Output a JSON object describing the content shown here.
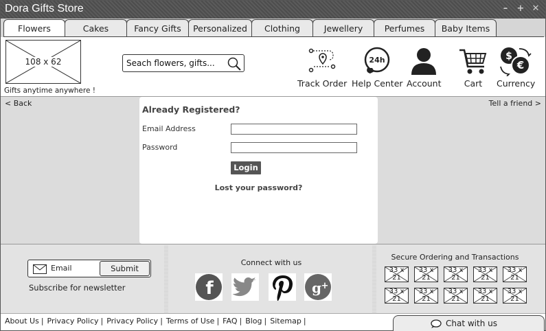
{
  "window": {
    "title": "Dora Gifts Store",
    "controls": [
      "–",
      "+",
      "✕"
    ]
  },
  "tabs": [
    {
      "label": "Flowers"
    },
    {
      "label": "Cakes"
    },
    {
      "label": "Fancy Gifts"
    },
    {
      "label": "Personalized"
    },
    {
      "label": "Clothing"
    },
    {
      "label": "Jewellery"
    },
    {
      "label": "Perfumes"
    },
    {
      "label": "Baby Items"
    }
  ],
  "header": {
    "logo_placeholder": "108 x 62",
    "tagline": "Gifts anytime anywhere !",
    "search_placeholder": "Seach flowers, gifts...",
    "icons": [
      {
        "label": "Track Order",
        "icon": "route-map-icon"
      },
      {
        "label": "Help Center",
        "icon": "24h-phone-icon"
      },
      {
        "label": "Account",
        "icon": "user-icon"
      },
      {
        "label": "Cart",
        "icon": "cart-icon"
      },
      {
        "label": "Currency",
        "icon": "currency-exchange-icon"
      }
    ]
  },
  "nav": {
    "back": "< Back",
    "tell_friend": "Tell a friend >"
  },
  "login": {
    "heading": "Already Registered?",
    "email_label": "Email Address",
    "email_value": "",
    "password_label": "Password",
    "password_value": "",
    "button": "Login",
    "lost_password": "Lost your password?"
  },
  "newsletter": {
    "email_placeholder": "Email",
    "submit": "Submit",
    "caption": "Subscribe for newsletter"
  },
  "connect": {
    "title": "Connect with us",
    "networks": [
      "facebook",
      "twitter",
      "pinterest",
      "google-plus"
    ]
  },
  "secure": {
    "title": "Secure Ordering and Transactions",
    "badge_line1": "33 x",
    "badge_line2": "21"
  },
  "footer_links": [
    "About Us",
    "Privacy Policy",
    "Privacy Policy",
    "Terms of Use",
    "FAQ",
    "Blog",
    "Sitemap"
  ],
  "chat": {
    "label": "Chat with us"
  },
  "colors": {
    "titlebar": "#555555",
    "button_dark": "#555555",
    "panel": "#dcdcdc"
  }
}
